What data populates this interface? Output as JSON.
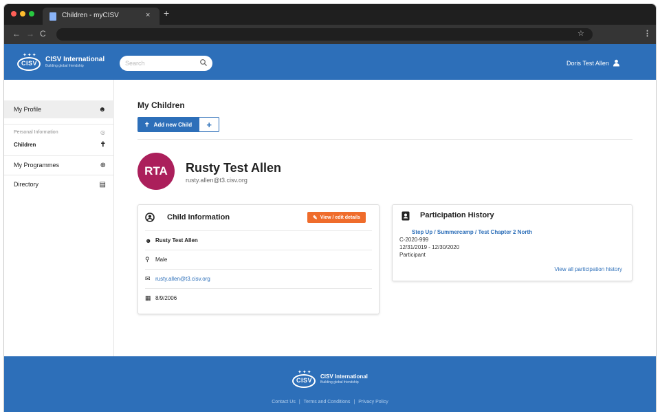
{
  "browser": {
    "tab_title": "Children - myCISV",
    "close_glyph": "×",
    "new_tab_glyph": "+",
    "back_glyph": "←",
    "forward_glyph": "→",
    "reload_glyph": "C",
    "bookmark_glyph": "☆",
    "menu_glyph": "⋮"
  },
  "header": {
    "logo_word": "CISV",
    "logo_name": "CISV International",
    "logo_tagline": "Building global friendship",
    "search_placeholder": "Search",
    "user_name": "Doris Test Allen"
  },
  "sidebar": {
    "my_profile": "My Profile",
    "personal_information": "Personal Information",
    "children": "Children",
    "my_programmes": "My Programmes",
    "directory": "Directory"
  },
  "main": {
    "page_title": "My Children",
    "add_child_label": "Add new Child",
    "add_plus": "+"
  },
  "child": {
    "initials": "RTA",
    "name": "Rusty Test Allen",
    "email": "rusty.allen@t3.cisv.org"
  },
  "child_info": {
    "title": "Child Information",
    "edit_label": "View / edit details",
    "full_name": "Rusty Test Allen",
    "gender": "Male",
    "email": "rusty.allen@t3.cisv.org",
    "birth_date": "8/9/2006"
  },
  "participation": {
    "title": "Participation History",
    "programme_link": "Step Up / Summercamp / Test Chapter 2 North",
    "code": "C-2020-999",
    "dates": "12/31/2019 - 12/30/2020",
    "role": "Participant",
    "view_all": "View all participation history"
  },
  "footer": {
    "logo_word": "CISV",
    "logo_name": "CISV International",
    "logo_tagline": "Building global friendship",
    "links": [
      "Contact Us",
      "Terms and Conditions",
      "Privacy Policy"
    ],
    "separator": "|"
  },
  "colors": {
    "brand_blue": "#2d6fb9",
    "avatar": "#ab1f5b",
    "edit_button": "#ef6c2b"
  }
}
